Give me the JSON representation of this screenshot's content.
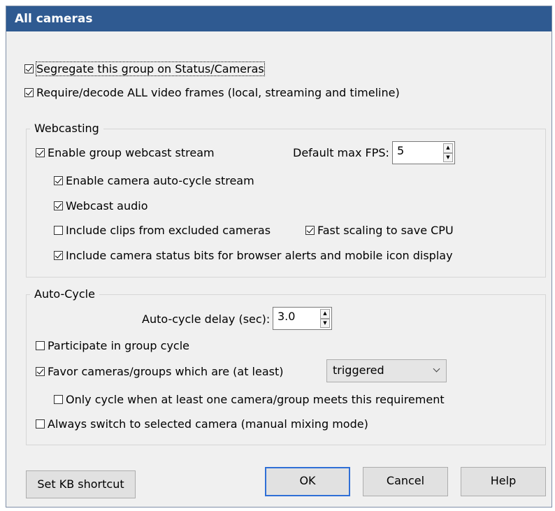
{
  "window": {
    "title": "All cameras"
  },
  "options": {
    "segregate": {
      "label": "Segregate this group on Status/Cameras",
      "checked": true
    },
    "require_all_frames": {
      "label": "Require/decode ALL video frames (local, streaming and timeline)",
      "checked": true
    }
  },
  "webcasting": {
    "title": "Webcasting",
    "enable_stream": {
      "label": "Enable group webcast stream",
      "checked": true
    },
    "max_fps": {
      "label": "Default max FPS:",
      "value": "5"
    },
    "auto_cycle_stream": {
      "label": "Enable camera auto-cycle stream",
      "checked": true
    },
    "audio": {
      "label": "Webcast audio",
      "checked": true
    },
    "include_clips": {
      "label": "Include clips from excluded cameras",
      "checked": false
    },
    "fast_scaling": {
      "label": "Fast scaling to save CPU",
      "checked": true
    },
    "status_bits": {
      "label": "Include camera status bits for browser alerts and mobile icon display",
      "checked": true
    }
  },
  "auto_cycle": {
    "title": "Auto-Cycle",
    "delay": {
      "label": "Auto-cycle delay (sec):",
      "value": "3.0"
    },
    "participate": {
      "label": "Participate in group cycle",
      "checked": false
    },
    "favor": {
      "label": "Favor cameras/groups which are (at least)",
      "checked": true
    },
    "favor_select": {
      "value": "triggered"
    },
    "only_cycle": {
      "label": "Only cycle when at least one camera/group meets this requirement",
      "checked": false
    },
    "always_switch": {
      "label": "Always switch to selected camera (manual mixing mode)",
      "checked": false
    }
  },
  "buttons": {
    "kb_shortcut": "Set KB shortcut",
    "ok": "OK",
    "cancel": "Cancel",
    "help": "Help"
  }
}
